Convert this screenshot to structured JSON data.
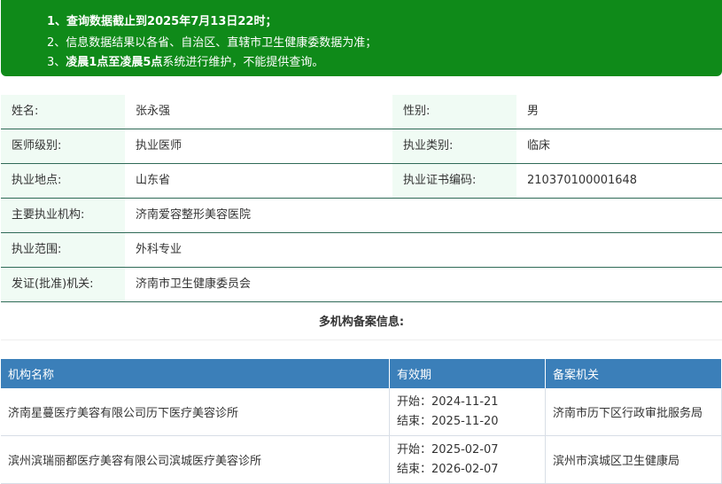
{
  "notice": {
    "line1": "1、查询数据截止到2025年7月13日22时；",
    "line2": "2、信息数据结果以各省、自治区、直辖市卫生健康委数据为准；",
    "line3_prefix": "3、",
    "line3_bold": "凌晨1点至凌晨5点",
    "line3_rest": "系统进行维护，不能提供查询。"
  },
  "info": {
    "name_label": "姓名:",
    "name": "张永强",
    "gender_label": "性别:",
    "gender": "男",
    "level_label": "医师级别:",
    "level": "执业医师",
    "category_label": "执业类别:",
    "category": "临床",
    "location_label": "执业地点:",
    "location": "山东省",
    "cert_label": "执业证书编码:",
    "cert": "210370100001648",
    "institution_label": "主要执业机构:",
    "institution": "济南爱容整形美容医院",
    "scope_label": "执业范围:",
    "scope": "外科专业",
    "issuer_label": "发证(批准)机关:",
    "issuer": "济南市卫生健康委员会"
  },
  "multi_title": "多机构备案信息:",
  "registrations": {
    "headers": [
      "机构名称",
      "有效期",
      "备案机关"
    ],
    "rows": [
      {
        "org": "济南星蔓医疗美容有限公司历下医疗美容诊所",
        "start": "开始：2024-11-21",
        "end": "结束：2025-11-20",
        "authority": "济南市历下区行政审批服务局"
      },
      {
        "org": "滨州滨瑞丽都医疗美容有限公司滨城医疗美容诊所",
        "start": "开始：2025-02-07",
        "end": "结束：2026-02-07",
        "authority": "滨州市滨城区卫生健康局"
      }
    ]
  }
}
